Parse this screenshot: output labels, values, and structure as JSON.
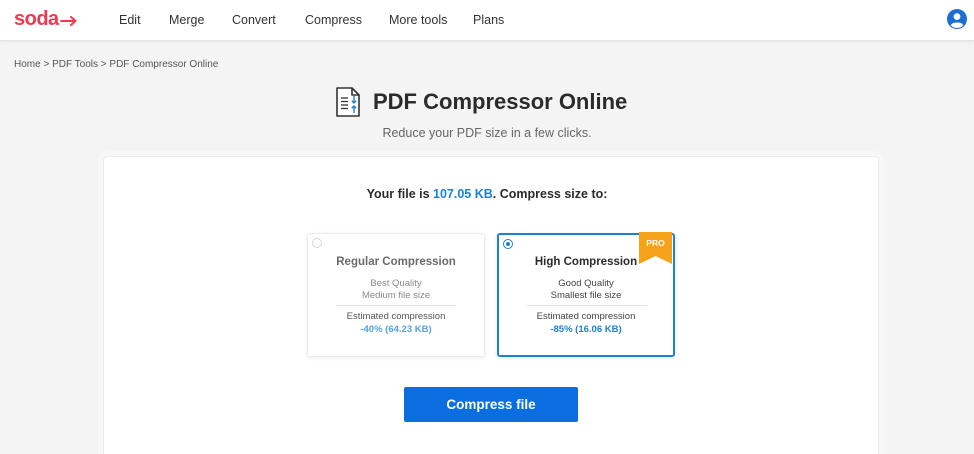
{
  "header": {
    "logo": "soda",
    "nav": [
      "Edit",
      "Merge",
      "Convert",
      "Compress",
      "More tools",
      "Plans"
    ]
  },
  "breadcrumb": "Home > PDF Tools > PDF Compressor Online",
  "page": {
    "title": "PDF Compressor Online",
    "subtitle": "Reduce your PDF size in a few clicks."
  },
  "file_info": {
    "prefix": "Your file is ",
    "size": "107.05 KB",
    "suffix": ". Compress size to:"
  },
  "options": [
    {
      "name": "Regular Compression",
      "line1": "Best Quality",
      "line2": "Medium file size",
      "estimate_label": "Estimated compression",
      "estimate_value": "-40% (64.23 KB)",
      "selected": false
    },
    {
      "name": "High Compression",
      "line1": "Good Quality",
      "line2": "Smallest file size",
      "estimate_label": "Estimated compression",
      "estimate_value": "-85% (16.06 KB)",
      "selected": true,
      "badge": "PRO"
    }
  ],
  "compress_button": "Compress file",
  "colors": {
    "brand": "#f0394c",
    "accent": "#1a82d6",
    "button": "#0a6ee0",
    "pro_badge": "#f6a21b"
  },
  "icons": [
    "soda-arrow-icon",
    "user-avatar-icon",
    "pdf-compress-icon",
    "radio-icon"
  ]
}
